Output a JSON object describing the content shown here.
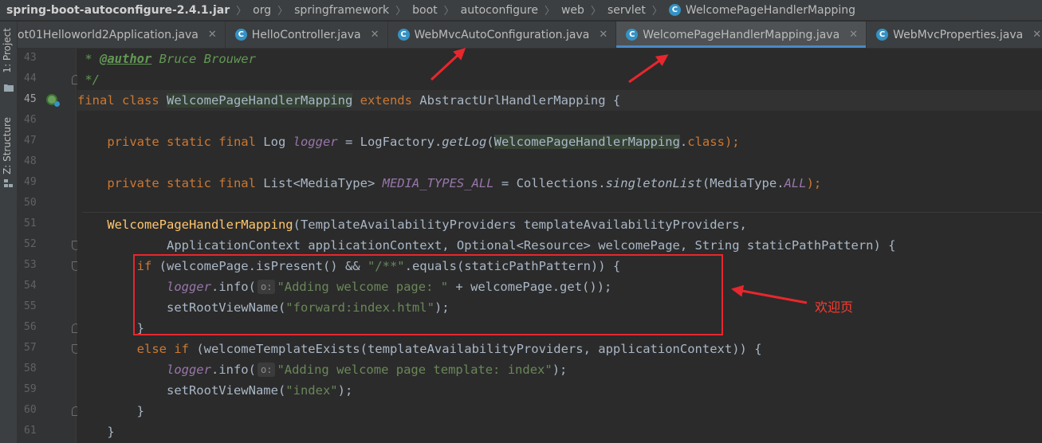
{
  "breadcrumb": {
    "jar": "spring-boot-autoconfigure-2.4.1.jar",
    "segments": [
      "org",
      "springframework",
      "boot",
      "autoconfigure",
      "web",
      "servlet"
    ],
    "current": "WelcomePageHandlerMapping"
  },
  "tool_strip": {
    "project": "1: Project",
    "structure": "Z: Structure"
  },
  "tabs": [
    {
      "label": "ot01Helloworld2Application.java",
      "active": false
    },
    {
      "label": "HelloController.java",
      "active": false
    },
    {
      "label": "WebMvcAutoConfiguration.java",
      "active": false
    },
    {
      "label": "WelcomePageHandlerMapping.java",
      "active": true
    },
    {
      "label": "WebMvcProperties.java",
      "active": false
    }
  ],
  "gutter": {
    "line_numbers": [
      "43",
      "44",
      "45",
      "46",
      "47",
      "48",
      "49",
      "50",
      "51",
      "52",
      "53",
      "54",
      "55",
      "56",
      "57",
      "58",
      "59",
      "60",
      "61"
    ],
    "current_line": "45"
  },
  "code": {
    "l43_star": " * ",
    "l43_tag": "@author",
    "l43_name": " Bruce Brouwer",
    "l44": " */",
    "l45_a": "final class ",
    "l45_b": "WelcomePageHandlerMapping",
    "l45_c": " extends ",
    "l45_d": "AbstractUrlHandlerMapping {",
    "l47_a": "    private static final ",
    "l47_b": "Log ",
    "l47_c": "logger",
    "l47_d": " = LogFactory.",
    "l47_e": "getLog",
    "l47_f": "(",
    "l47_g": "WelcomePageHandlerMapping",
    "l47_h": ".",
    "l47_i": "class",
    "l47_j": ");",
    "l49_a": "    private static final ",
    "l49_b": "List<MediaType> ",
    "l49_c": "MEDIA_TYPES_ALL",
    "l49_d": " = Collections.",
    "l49_e": "singletonList",
    "l49_f": "(MediaType.",
    "l49_g": "ALL",
    "l49_h": ");",
    "l51_a": "    ",
    "l51_b": "WelcomePageHandlerMapping",
    "l51_c": "(TemplateAvailabilityProviders templateAvailabilityProviders,",
    "l52": "            ApplicationContext applicationContext, Optional<Resource> welcomePage, String staticPathPattern) {",
    "l53_a": "        ",
    "l53_b": "if",
    "l53_c": " (welcomePage.isPresent() && ",
    "l53_d": "\"/**\"",
    "l53_e": ".equals(staticPathPattern)) {",
    "l54_a": "            ",
    "l54_b": "logger",
    "l54_c": ".info(",
    "l54_hint": "o:",
    "l54_d": "\"Adding welcome page: \"",
    "l54_e": " + welcomePage.get());",
    "l55_a": "            setRootViewName(",
    "l55_b": "\"forward:index.html\"",
    "l55_c": ");",
    "l56": "        }",
    "l57_a": "        ",
    "l57_b": "else if",
    "l57_c": " (welcomeTemplateExists(templateAvailabilityProviders, applicationContext)) {",
    "l58_a": "            ",
    "l58_b": "logger",
    "l58_c": ".info(",
    "l58_hint": "o:",
    "l58_d": "\"Adding welcome page template: index\"",
    "l58_e": ");",
    "l59_a": "            setRootViewName(",
    "l59_b": "\"index\"",
    "l59_c": ");",
    "l60": "        }",
    "l61": "    }"
  },
  "annotation": {
    "label": "欢迎页",
    "color": "#e8262d"
  },
  "colors": {
    "keyword": "#cc7832",
    "string": "#6a8759",
    "field": "#9876aa",
    "method_decl": "#ffc66d",
    "active_tab_underline": "#4a88c7"
  }
}
